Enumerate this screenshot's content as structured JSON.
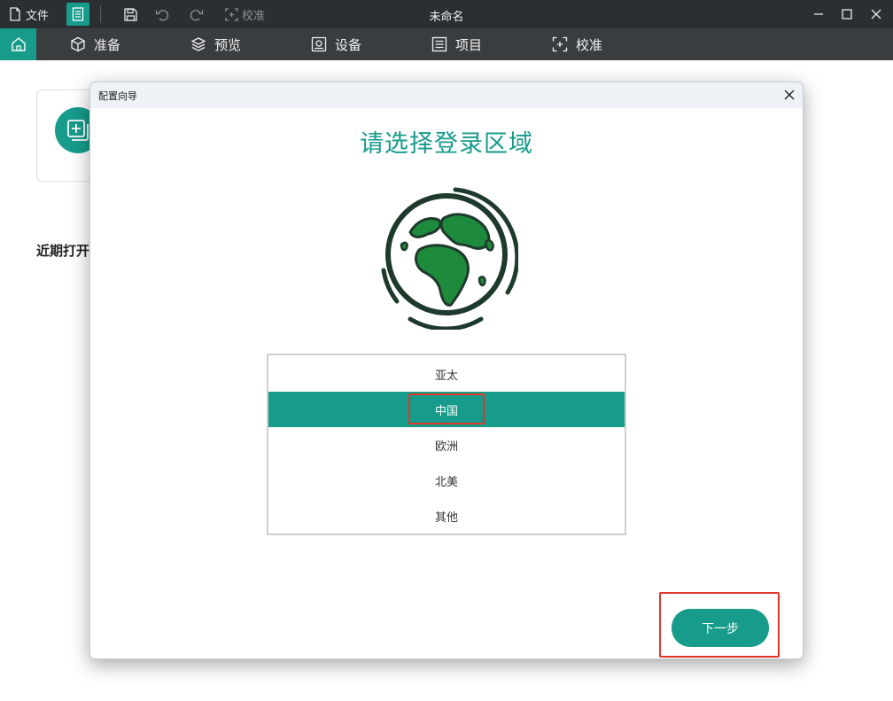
{
  "titlebar": {
    "file_label": "文件",
    "calibrate_label": "校准",
    "document_title": "未命名"
  },
  "nav": {
    "items": [
      {
        "label": "准备",
        "icon": "box-icon"
      },
      {
        "label": "预览",
        "icon": "layers-icon"
      },
      {
        "label": "设备",
        "icon": "device-icon"
      },
      {
        "label": "项目",
        "icon": "list-icon"
      },
      {
        "label": "校准",
        "icon": "calibrate-icon"
      }
    ]
  },
  "home": {
    "recent_label": "近期打开"
  },
  "dialog": {
    "title": "配置向导",
    "heading": "请选择登录区域",
    "regions": [
      "亚太",
      "中国",
      "欧洲",
      "北美",
      "其他"
    ],
    "selected_region": "中国",
    "next_label": "下一步"
  },
  "colors": {
    "accent": "#179b8b",
    "titlebar_bg": "#2c2f32",
    "navbar_bg": "#3a3d40",
    "annotation_red": "#e0362a",
    "globe_land": "#1e8a3c",
    "globe_outline": "#1e3a2c"
  }
}
